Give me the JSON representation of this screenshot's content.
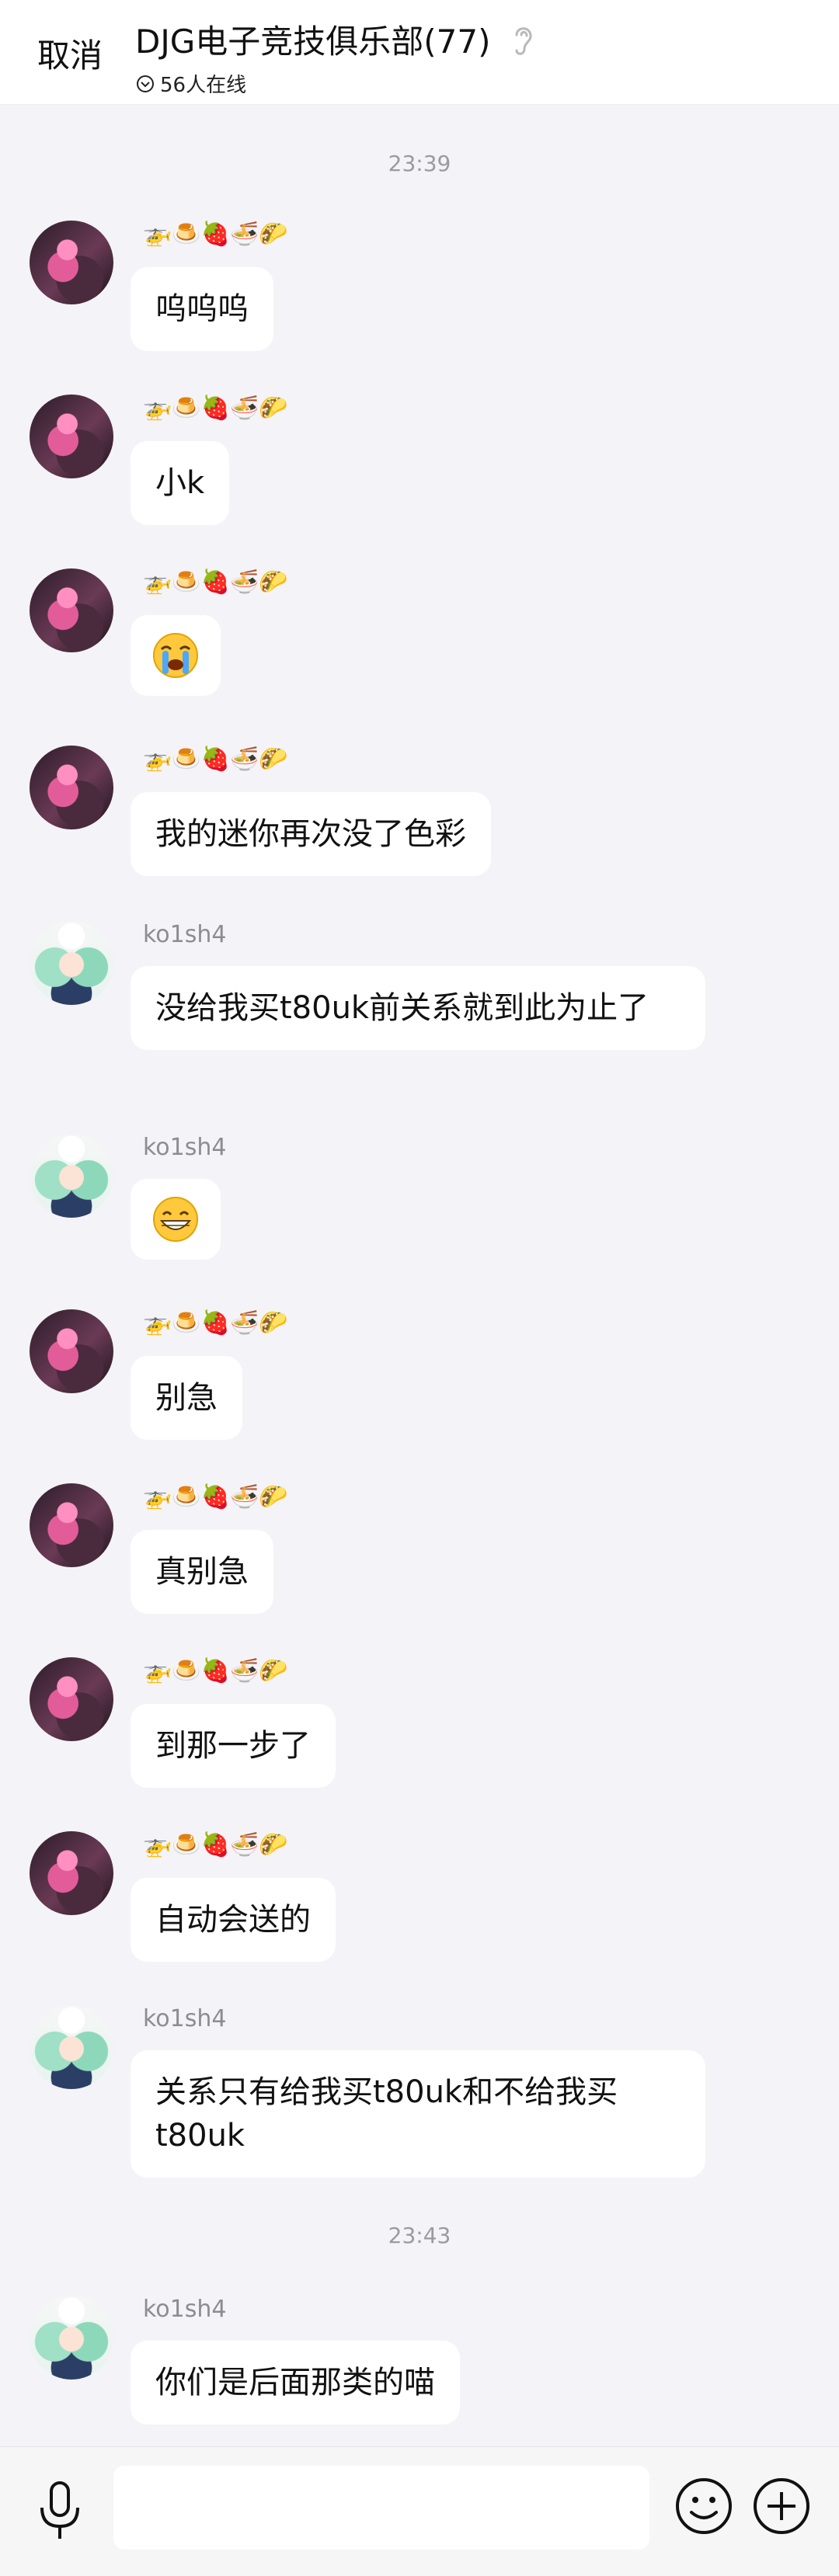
{
  "header": {
    "cancel_label": "取消",
    "title": "DJG电子竞技俱乐部(77)",
    "online": "56人在线"
  },
  "timestamps": [
    "23:39",
    "23:43"
  ],
  "senders": {
    "pink_name_emoji": "🚁🍮🍓🍜🌮",
    "green_name": "ko1sh4"
  },
  "messages": [
    {
      "text": "呜呜呜"
    },
    {
      "text": "小k"
    },
    {
      "text": "",
      "emoji": "crying-face"
    },
    {
      "text": "我的迷你再次没了色彩"
    },
    {
      "text": "没给我买t80uk前关系就到此为止了"
    },
    {
      "text": "",
      "emoji": "grinning-face"
    },
    {
      "text": "别急"
    },
    {
      "text": "真别急"
    },
    {
      "text": "到那一步了"
    },
    {
      "text": "自动会送的"
    },
    {
      "text": "关系只有给我买t80uk和不给我买t80uk"
    },
    {
      "text": "你们是后面那类的喵"
    }
  ],
  "input": {
    "placeholder": ""
  },
  "icons": {
    "voice": "microphone-icon",
    "emoji": "smile-icon",
    "more": "plus-icon",
    "ear": "ear-icon"
  },
  "colors": {
    "background": "#f4f3f7",
    "bubble": "#ffffff",
    "muted_text": "#9b9aa1"
  }
}
